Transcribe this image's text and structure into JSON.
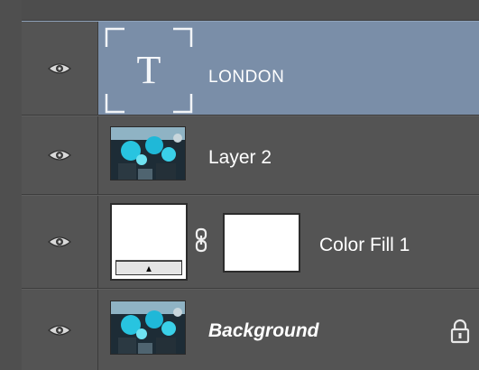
{
  "layers": [
    {
      "name": "LONDON",
      "type": "text",
      "selected": true,
      "thumb_glyph": "T"
    },
    {
      "name": "Layer 2",
      "type": "image",
      "selected": false
    },
    {
      "name": "Color Fill 1",
      "type": "fill",
      "selected": false
    },
    {
      "name": "Background",
      "type": "image",
      "selected": false,
      "locked": true
    }
  ],
  "colors": {
    "selection": "#7a8ea8",
    "panel": "#545454"
  },
  "icons": {
    "visibility": "eye-icon",
    "lock": "lock-icon",
    "link": "chain-link-icon",
    "text_layer": "text-layer-icon"
  }
}
